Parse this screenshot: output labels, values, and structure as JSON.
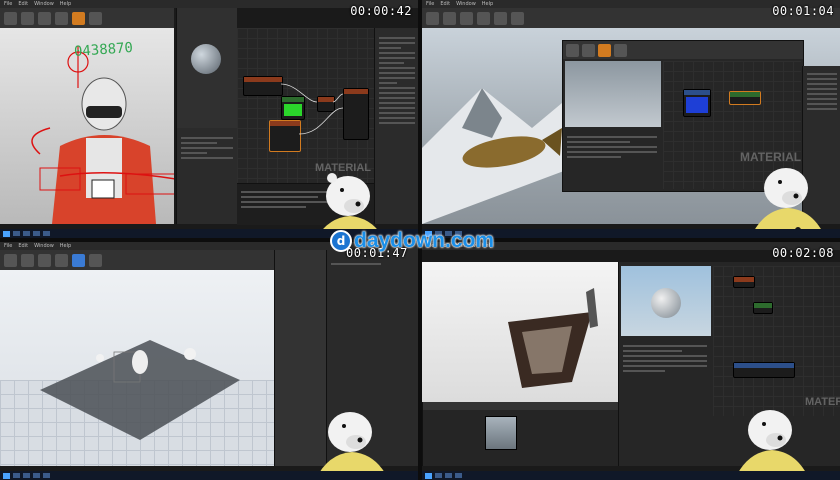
{
  "timecodes": [
    "00:00:42",
    "00:01:04",
    "00:01:47",
    "00:02:08"
  ],
  "watermark": {
    "text": "daydown.com",
    "logo": "d"
  },
  "menu_items": [
    "File",
    "Edit",
    "Window",
    "Help"
  ],
  "graph_watermark": "MATERIAL",
  "handwriting": "0438870",
  "icons": [
    "gear-icon",
    "save-icon",
    "play-icon",
    "windows-start-icon"
  ],
  "colors": {
    "accent": "#d27b20",
    "brand": "#1b8fe8",
    "green_node": "#2bd62b",
    "blue_node": "#1e3fd6"
  }
}
